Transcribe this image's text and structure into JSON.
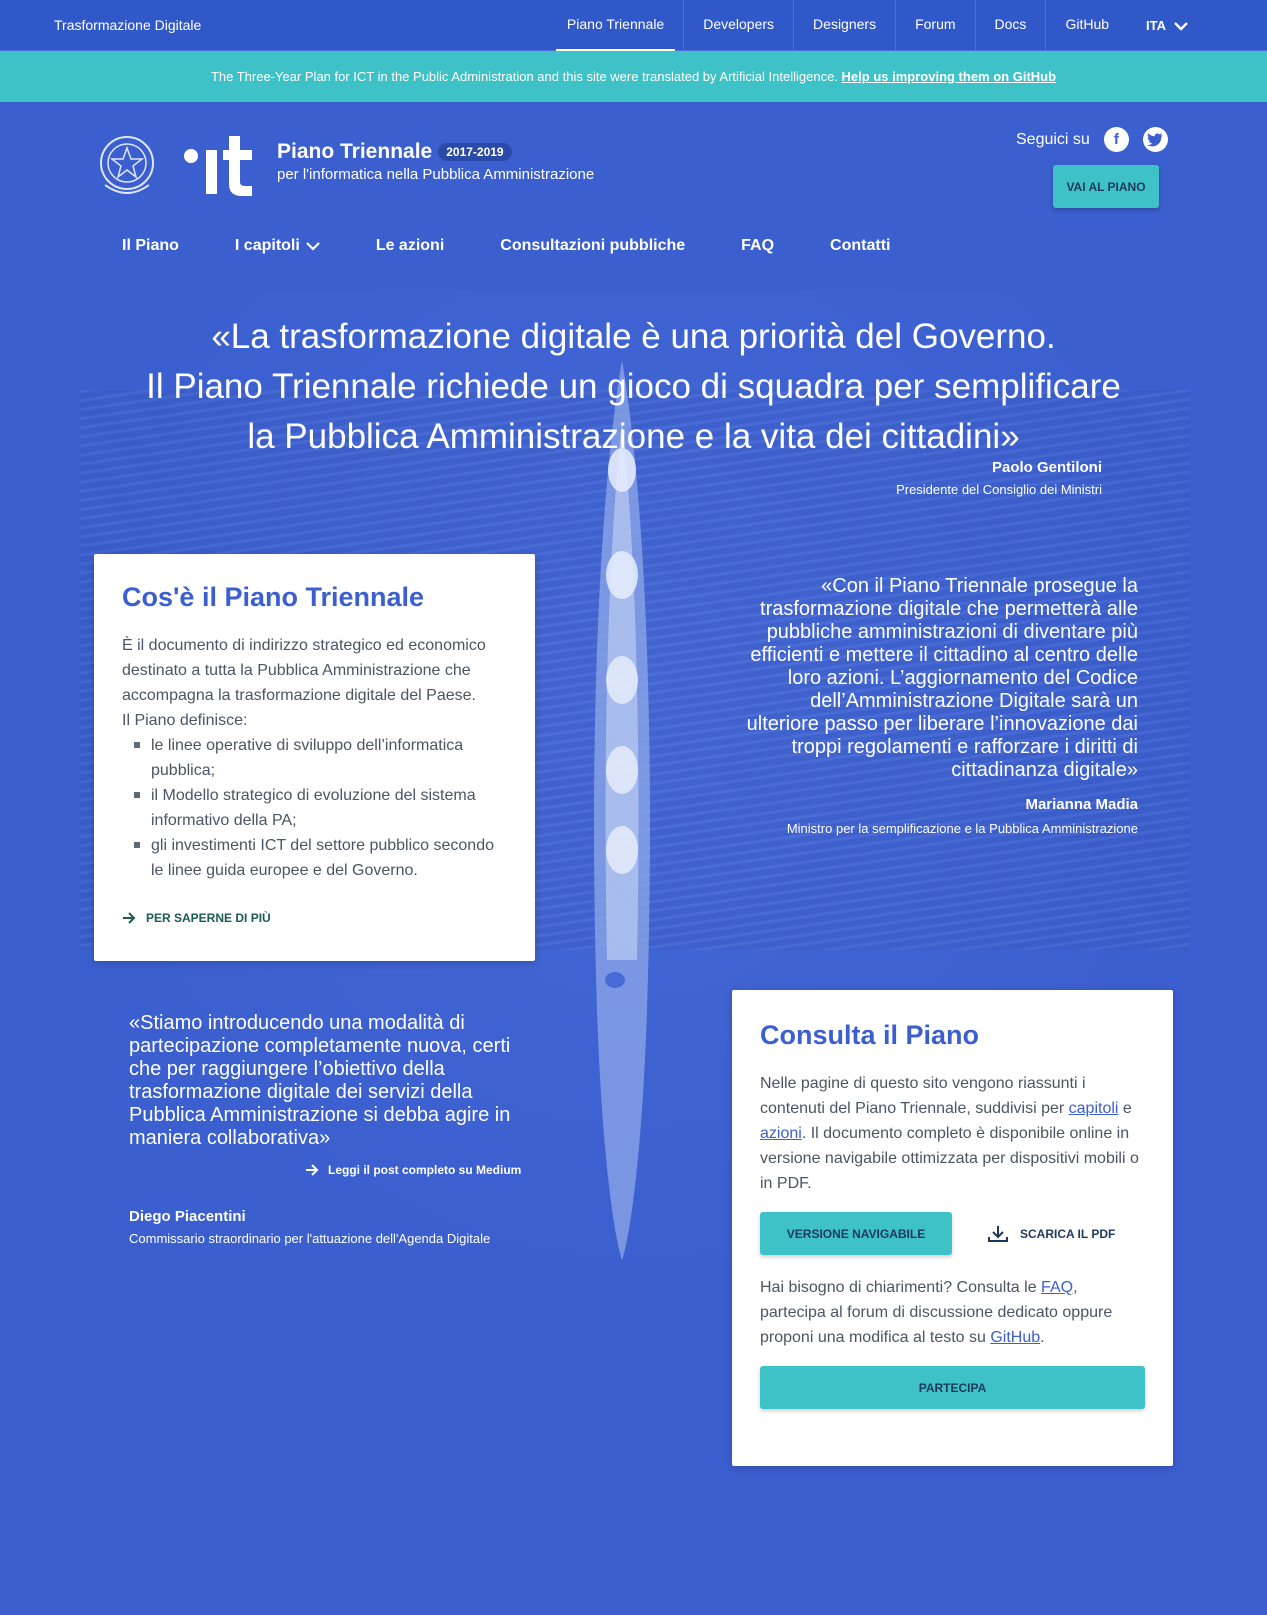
{
  "topbar": {
    "brand": "Trasformazione Digitale",
    "nav": [
      "Piano Triennale",
      "Developers",
      "Designers",
      "Forum",
      "Docs",
      "GitHub"
    ],
    "lang": "ITA"
  },
  "banner": {
    "text": "The Three-Year Plan for ICT in the Public Administration and this site were translated by Artificial Intelligence.",
    "link": "Help us improving them on GitHub"
  },
  "header": {
    "title": "Piano Triennale",
    "years": "2017-2019",
    "subtitle": "per l'informatica nella Pubblica Amministrazione",
    "follow": "Seguici su",
    "social_icons": [
      "facebook-icon",
      "twitter-icon"
    ],
    "cta": "VAI AL PIANO"
  },
  "mainnav": {
    "items": [
      "Il Piano",
      "I capitoli",
      "Le azioni",
      "Consultazioni pubbliche",
      "FAQ",
      "Contatti"
    ]
  },
  "hero_quote": {
    "line1": "«La trasformazione digitale è una priorità del Governo.",
    "line2": "Il Piano Triennale richiede un gioco di squadra per semplificare",
    "line3": "la Pubblica Amministrazione e la vita dei cittadini»",
    "author": "Paolo Gentiloni",
    "role": "Presidente del Consiglio dei Ministri"
  },
  "card_about": {
    "title": "Cos'è il Piano Triennale",
    "intro": "È il documento di indirizzo strategico ed economico destinato a tutta la Pubblica Amministrazione che accompagna la trasformazione digitale del Paese.",
    "defines": "Il Piano definisce:",
    "bullets": [
      "le linee operative di sviluppo dell’informatica pubblica;",
      "il Modello strategico di evoluzione del sistema informativo della PA;",
      "gli investimenti ICT del settore pubblico secondo le linee guida europee e del Governo."
    ],
    "more": "PER SAPERNE DI PIÙ"
  },
  "quote_madia": {
    "text": "«Con il Piano Triennale prosegue la trasformazione digitale che permetterà alle pubbliche amministrazioni di diventare più efficienti e mettere il cittadino al centro delle loro azioni. L’aggiornamento del Codice dell’Amministrazione Digitale sarà un ulteriore passo per liberare l’innovazione dai troppi regolamenti e rafforzare i diritti di cittadinanza digitale»",
    "author": "Marianna Madia",
    "role": "Ministro per la semplificazione e la Pubblica Amministrazione"
  },
  "quote_piacentini": {
    "text": "«Stiamo introducendo una modalità di partecipazione completamente nuova, certi che per raggiungere l’obiettivo della trasformazione digitale dei servizi della Pubblica Amministrazione si debba agire in maniera collaborativa»",
    "link": "Leggi il post completo su Medium",
    "author": "Diego Piacentini",
    "role": "Commissario straordinario per l'attuazione dell'Agenda Digitale"
  },
  "card_consult": {
    "title": "Consulta il Piano",
    "p1_a": "Nelle pagine di questo sito vengono riassunti i contenuti del Piano Triennale, suddivisi per ",
    "link_capitoli": "capitoli",
    "p1_b": " e ",
    "link_azioni": "azioni",
    "p1_c": ". Il documento completo è disponibile online in versione navigabile ottimizzata per dispositivi mobili o in PDF.",
    "btn_nav": "VERSIONE NAVIGABILE",
    "btn_pdf": "SCARICA IL PDF",
    "p2_a": "Hai bisogno di chiarimenti? Consulta le ",
    "link_faq": "FAQ",
    "p2_b": ", partecipa al forum di discussione dedicato oppure proponi una modifica al testo su ",
    "link_github": "GitHub",
    "p2_c": ".",
    "btn_part": "PARTECIPA"
  }
}
